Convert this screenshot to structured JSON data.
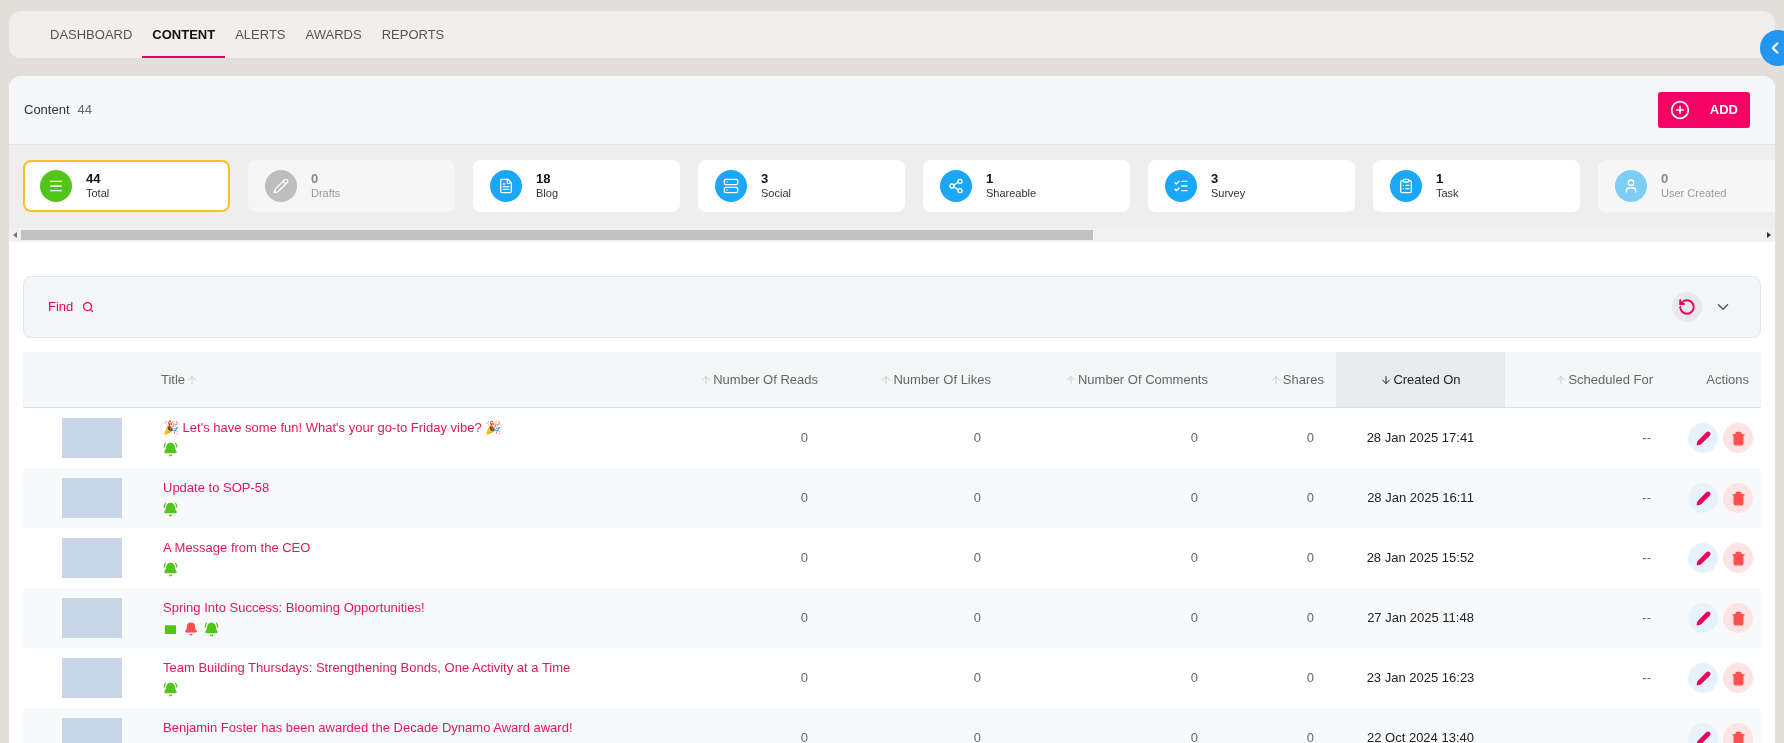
{
  "nav_tabs": [
    {
      "label": "DASHBOARD",
      "selected": false
    },
    {
      "label": "CONTENT",
      "selected": true
    },
    {
      "label": "ALERTS",
      "selected": false
    },
    {
      "label": "AWARDS",
      "selected": false
    },
    {
      "label": "REPORTS",
      "selected": false
    }
  ],
  "header": {
    "title": "Content",
    "count": "44",
    "add_button": "ADD"
  },
  "stat_cards": [
    {
      "kind": "total",
      "count": "44",
      "label": "Total",
      "selected": true,
      "disabled": false,
      "color": "#52c41a"
    },
    {
      "kind": "drafts",
      "count": "0",
      "label": "Drafts",
      "selected": false,
      "disabled": true,
      "color": "#bdbdbd"
    },
    {
      "kind": "blog",
      "count": "18",
      "label": "Blog",
      "selected": false,
      "disabled": false,
      "color": "#1aa7f5"
    },
    {
      "kind": "social",
      "count": "3",
      "label": "Social",
      "selected": false,
      "disabled": false,
      "color": "#1aa7f5"
    },
    {
      "kind": "shareable",
      "count": "1",
      "label": "Shareable",
      "selected": false,
      "disabled": false,
      "color": "#1aa7f5"
    },
    {
      "kind": "survey",
      "count": "3",
      "label": "Survey",
      "selected": false,
      "disabled": false,
      "color": "#1aa7f5"
    },
    {
      "kind": "task",
      "count": "1",
      "label": "Task",
      "selected": false,
      "disabled": false,
      "color": "#1aa7f5"
    },
    {
      "kind": "user",
      "count": "0",
      "label": "User Created",
      "selected": false,
      "disabled": true,
      "color": "#7dcdf7"
    }
  ],
  "filter": {
    "label": "Find"
  },
  "table": {
    "columns": [
      {
        "kind": "thumb"
      },
      {
        "kind": "title",
        "label": "Title",
        "sorted": false
      },
      {
        "kind": "number",
        "label": "Number Of Reads",
        "sorted": false
      },
      {
        "kind": "number",
        "label": "Number Of Likes",
        "sorted": false
      },
      {
        "kind": "number",
        "label": "Number Of Comments",
        "sorted": false
      },
      {
        "kind": "number",
        "label": "Shares",
        "sorted": false
      },
      {
        "kind": "date",
        "label": "Created On",
        "sorted": true
      },
      {
        "kind": "number",
        "label": "Scheduled For",
        "sorted": false
      },
      {
        "kind": "actions",
        "label": "Actions"
      }
    ],
    "rows": [
      {
        "title": "🎉 Let's have some fun! What's your go-to Friday vibe? 🎉",
        "icons": [
          {
            "kind": "bell-ring"
          }
        ],
        "reads": "0",
        "likes": "0",
        "comments": "0",
        "shares": "0",
        "created_on": "28 Jan 2025 17:41",
        "scheduled_for": "--"
      },
      {
        "title": "Update to SOP-58",
        "icons": [
          {
            "kind": "bell-ring"
          }
        ],
        "reads": "0",
        "likes": "0",
        "comments": "0",
        "shares": "0",
        "created_on": "28 Jan 2025 16:11",
        "scheduled_for": "--"
      },
      {
        "title": "A Message from the CEO",
        "icons": [
          {
            "kind": "bell-ring"
          }
        ],
        "reads": "0",
        "likes": "0",
        "comments": "0",
        "shares": "0",
        "created_on": "28 Jan 2025 15:52",
        "scheduled_for": "--"
      },
      {
        "title": "Spring Into Success: Blooming Opportunities!",
        "icons": [
          {
            "kind": "mail"
          },
          {
            "kind": "bell"
          },
          {
            "kind": "bell-ring"
          }
        ],
        "reads": "0",
        "likes": "0",
        "comments": "0",
        "shares": "0",
        "created_on": "27 Jan 2025 11:48",
        "scheduled_for": "--"
      },
      {
        "title": "Team Building Thursdays: Strengthening Bonds, One Activity at a Time",
        "icons": [
          {
            "kind": "bell-ring"
          }
        ],
        "reads": "0",
        "likes": "0",
        "comments": "0",
        "shares": "0",
        "created_on": "23 Jan 2025 16:23",
        "scheduled_for": "--"
      },
      {
        "title": "Benjamin Foster has been awarded the Decade Dynamo Award award!",
        "reads": "0",
        "likes": "0",
        "comments": "0",
        "shares": "0",
        "created_on": "22 Oct 2024 13:40"
      }
    ]
  }
}
